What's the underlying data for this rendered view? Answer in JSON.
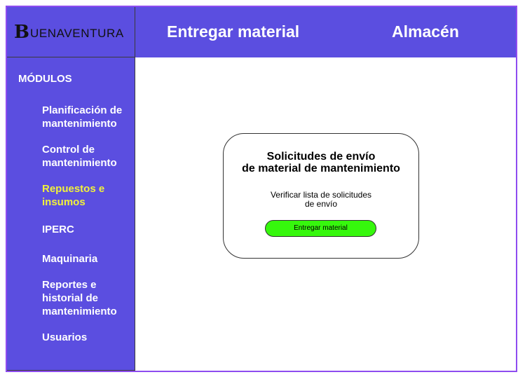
{
  "brand": {
    "logo_initial": "B",
    "logo_text": "UENAVENTURA"
  },
  "header": {
    "title": "Entregar material",
    "section": "Almacén"
  },
  "sidebar": {
    "heading": "MÓDULOS",
    "items": [
      {
        "label": "Planificación de mantenimiento",
        "active": false
      },
      {
        "label": "Control de mantenimiento",
        "active": false
      },
      {
        "label": "Repuestos e insumos",
        "active": true
      },
      {
        "label": "IPERC",
        "active": false
      },
      {
        "label": "Maquinaria",
        "active": false
      },
      {
        "label": "Reportes e historial de mantenimiento",
        "active": false
      },
      {
        "label": "Usuarios",
        "active": false
      }
    ]
  },
  "card": {
    "title": "Solicitudes de envío\nde material de mantenimiento",
    "description": "Verificar lista de solicitudes\nde envío",
    "button_label": "Entregar material"
  },
  "colors": {
    "primary": "#5b4ee0",
    "border": "#8e4cf0",
    "active_text": "#f2f23a",
    "button": "#36f70d"
  }
}
